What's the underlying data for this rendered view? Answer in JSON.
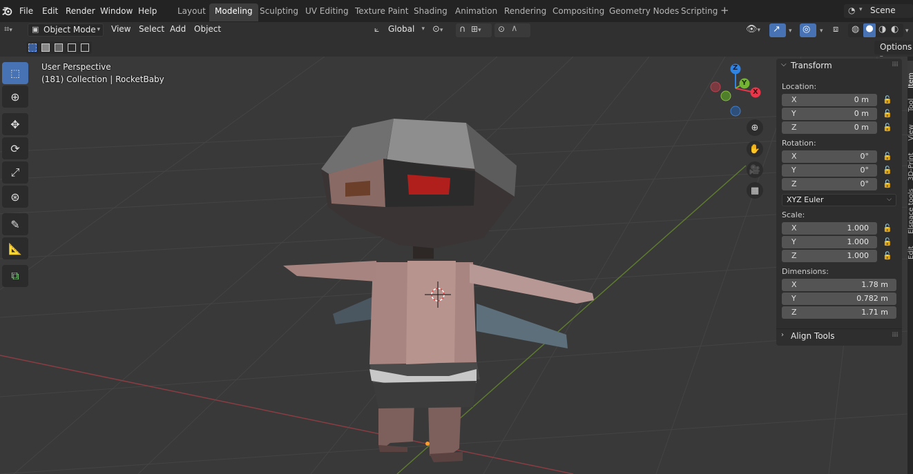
{
  "menu": [
    "File",
    "Edit",
    "Render",
    "Window",
    "Help"
  ],
  "workspaces": [
    "Layout",
    "Modeling",
    "Sculpting",
    "UV Editing",
    "Texture Paint",
    "Shading",
    "Animation",
    "Rendering",
    "Compositing",
    "Geometry Nodes",
    "Scripting"
  ],
  "active_workspace": "Modeling",
  "scene": {
    "label": "Scene"
  },
  "header": {
    "mode": "Object Mode",
    "view": "View",
    "select": "Select",
    "add": "Add",
    "object": "Object",
    "transform_orientation": "Global"
  },
  "options_label": "Options",
  "viewport": {
    "view_name": "User Perspective",
    "collection_info": "(181) Collection | RocketBaby",
    "gizmo": {
      "x": "X",
      "y": "Y",
      "z": "Z"
    }
  },
  "npanel": {
    "transform_title": "Transform",
    "location_label": "Location:",
    "location": [
      {
        "axis": "X",
        "value": "0 m"
      },
      {
        "axis": "Y",
        "value": "0 m"
      },
      {
        "axis": "Z",
        "value": "0 m"
      }
    ],
    "rotation_label": "Rotation:",
    "rotation": [
      {
        "axis": "X",
        "value": "0°"
      },
      {
        "axis": "Y",
        "value": "0°"
      },
      {
        "axis": "Z",
        "value": "0°"
      }
    ],
    "rotation_mode": "XYZ Euler",
    "scale_label": "Scale:",
    "scale": [
      {
        "axis": "X",
        "value": "1.000"
      },
      {
        "axis": "Y",
        "value": "1.000"
      },
      {
        "axis": "Z",
        "value": "1.000"
      }
    ],
    "dimensions_label": "Dimensions:",
    "dimensions": [
      {
        "axis": "X",
        "value": "1.78 m"
      },
      {
        "axis": "Y",
        "value": "0.782 m"
      },
      {
        "axis": "Z",
        "value": "1.71 m"
      }
    ],
    "align_tools_title": "Align Tools"
  },
  "side_tabs": [
    "Item",
    "Tool",
    "View",
    "3D-Print",
    "Elspace tools",
    "Edit"
  ],
  "colors": {
    "accent": "#4772b3",
    "axis_x": "#e8374a",
    "axis_y": "#73b532",
    "axis_z": "#2f83e3"
  },
  "icons": [
    "blender-logo-icon",
    "select-box-icon",
    "cursor-icon",
    "move-icon",
    "rotate-icon",
    "scale-icon",
    "transform-icon",
    "annotate-icon",
    "measure-icon",
    "add-cube-icon",
    "zoom-icon",
    "hand-icon",
    "camera-icon",
    "grid-icon",
    "lock-icon"
  ]
}
